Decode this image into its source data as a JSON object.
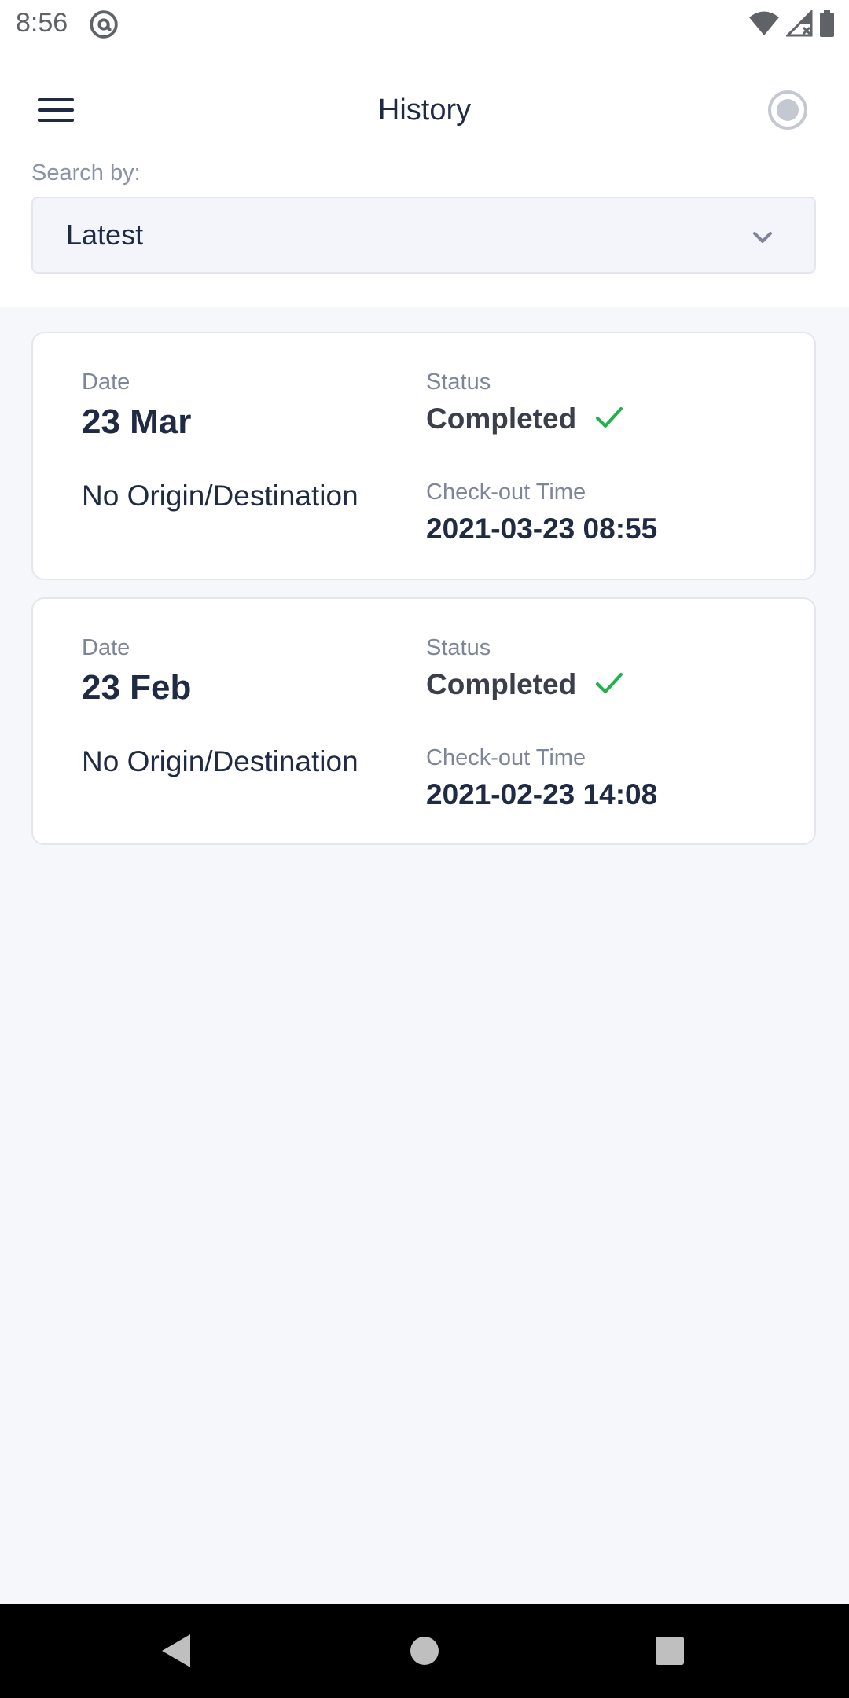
{
  "status_bar": {
    "time": "8:56",
    "left_icon": "at-sign-icon",
    "right_icons": [
      "wifi-icon",
      "signal-icon",
      "battery-icon"
    ]
  },
  "header": {
    "title": "History",
    "menu_icon": "hamburger-menu-icon",
    "action_icon": "record-icon"
  },
  "search": {
    "label": "Search by:",
    "selected": "Latest"
  },
  "history": {
    "items": [
      {
        "date_label": "Date",
        "date": "23 Mar",
        "route": "No Origin/Destination",
        "status_label": "Status",
        "status": "Completed",
        "checkout_label": "Check-out Time",
        "checkout_time": "2021-03-23 08:55"
      },
      {
        "date_label": "Date",
        "date": "23 Feb",
        "route": "No Origin/Destination",
        "status_label": "Status",
        "status": "Completed",
        "checkout_label": "Check-out Time",
        "checkout_time": "2021-02-23 14:08"
      }
    ]
  },
  "colors": {
    "primary_text": "#1f2a44",
    "muted_text": "#7d8699",
    "success": "#22b14c",
    "background": "#f6f7fb"
  },
  "nav": {
    "icons": [
      "back-icon",
      "home-icon",
      "recents-icon"
    ]
  }
}
